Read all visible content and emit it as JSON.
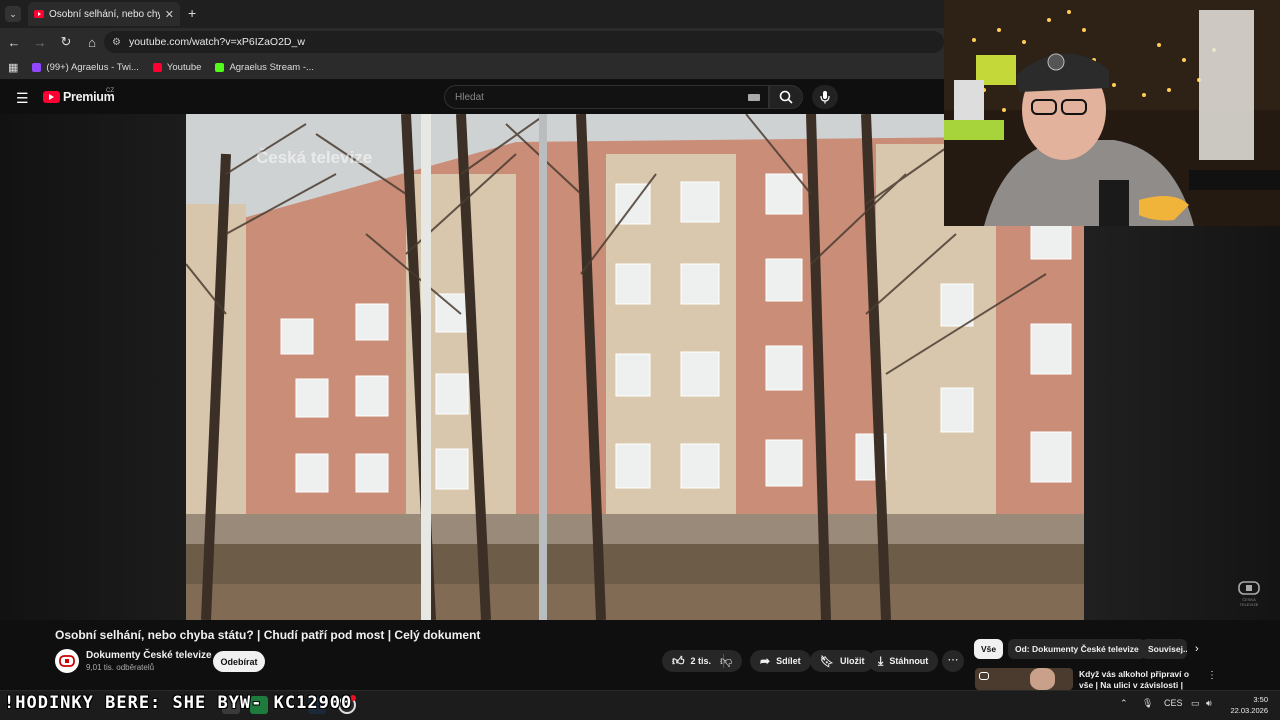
{
  "browser": {
    "tab_title": "Osobní selhání, nebo chyba státu",
    "url": "youtube.com/watch?v=xP6IZaO2D_w",
    "bookmarks": [
      {
        "label": "(99+) Agraelus - Twi...",
        "color": "#9146ff"
      },
      {
        "label": "Youtube",
        "color": "#ff0033"
      },
      {
        "label": "Agraelus Stream -...",
        "color": "#53fc18"
      }
    ]
  },
  "youtube": {
    "logo_text": "Premium",
    "logo_region": "CZ",
    "search_placeholder": "Hledat"
  },
  "video": {
    "watermark": "Česká televize",
    "corner_logo": "ČESKÁ TELEVIZE",
    "title": "Osobní selhání, nebo chyba státu? | Chudí patří pod most | Celý dokument",
    "channel": "Dokumenty České televize",
    "subscribers": "9,01 tis. odběratelů",
    "subscribe_label": "Odebírat",
    "likes": "2 tis.",
    "share_label": "Sdílet",
    "save_label": "Uložit",
    "download_label": "Stáhnout",
    "more_label": "⋯"
  },
  "related": {
    "chips": [
      "Vše",
      "Od: Dokumenty České televize",
      "Souvisej..."
    ],
    "first_title": "Když vás alkohol připraví o vše | Na ulici v závislosti | Celý..."
  },
  "taskbar": {
    "ticker": "!HODINKY BERE: SHE  BYW- KC12900",
    "language": "CES",
    "time": "3:50",
    "date": "22.03.2026"
  },
  "colors": {
    "youtube_red": "#ff0033",
    "background": "#0f0f0f",
    "pill": "#272727"
  }
}
